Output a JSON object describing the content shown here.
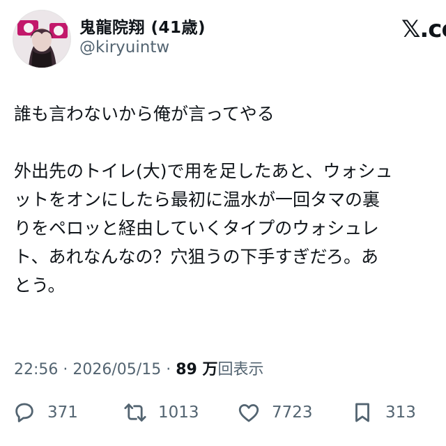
{
  "author": {
    "name": "鬼龍院翔 (41歳)",
    "handle": "@kiryuintw",
    "avatar_icon": "avatar-photo"
  },
  "source_label": "𝕏.co",
  "tweet": {
    "paragraphs": [
      [
        "誰も言わないから俺が言ってやる"
      ],
      [
        "外出先のトイレ(大)で用を足したあと、ウォシュ",
        "ットをオンにしたら最初に温水が一回タマの裏",
        "りをペロッと経由していくタイプのウォシュレ",
        "ト、あれなんなの？穴狙うの下手すぎだろ。あ",
        "とう。"
      ]
    ],
    "time": "22:56",
    "date": "2026/05/15",
    "views_count": "89 万",
    "views_label": "回表示",
    "separator": "·"
  },
  "actions": {
    "reply": {
      "icon": "reply-icon",
      "count": "371"
    },
    "retweet": {
      "icon": "retweet-icon",
      "count": "1013"
    },
    "like": {
      "icon": "heart-icon",
      "count": "7723"
    },
    "bookmark": {
      "icon": "bookmark-icon",
      "count": "313"
    }
  },
  "colors": {
    "text": "#0f1419",
    "muted": "#536471",
    "icon": "#536471"
  }
}
